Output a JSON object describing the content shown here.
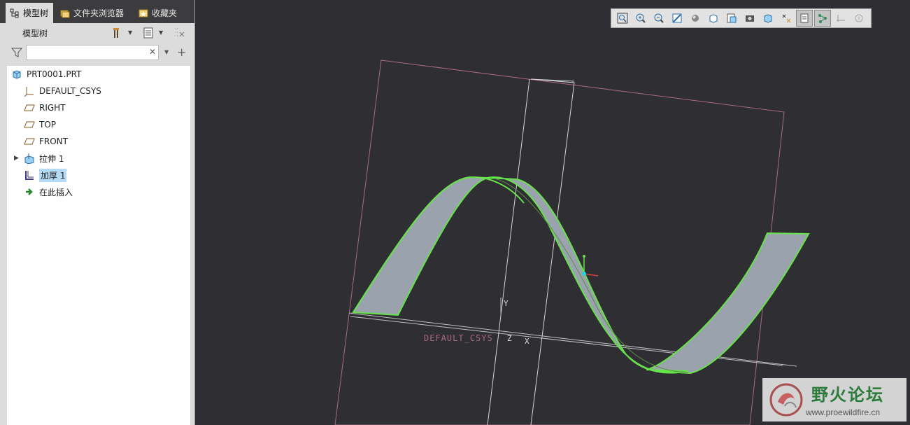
{
  "tabs": [
    {
      "label": "模型树",
      "icon": "tree-icon",
      "active": true
    },
    {
      "label": "文件夹浏览器",
      "icon": "folder-browser-icon",
      "active": false
    },
    {
      "label": "收藏夹",
      "icon": "favorites-icon",
      "active": false
    }
  ],
  "tree_header": {
    "title": "模型树",
    "settings_icon": "tools-icon",
    "show_icon": "list-icon",
    "extra_icon": "columns-icon"
  },
  "filter": {
    "placeholder": "",
    "value": "",
    "clear_icon": "close-icon",
    "add_icon": "plus-icon"
  },
  "tree": {
    "root": {
      "label": "PRT0001.PRT",
      "icon": "part-icon"
    },
    "items": [
      {
        "label": "DEFAULT_CSYS",
        "icon": "csys-icon"
      },
      {
        "label": "RIGHT",
        "icon": "datum-plane-icon"
      },
      {
        "label": "TOP",
        "icon": "datum-plane-icon"
      },
      {
        "label": "FRONT",
        "icon": "datum-plane-icon"
      },
      {
        "label": "拉伸 1",
        "icon": "extrude-icon",
        "expandable": true
      },
      {
        "label": "加厚 1",
        "icon": "thicken-icon",
        "selected": true
      },
      {
        "label": "在此插入",
        "icon": "insert-here-icon"
      }
    ]
  },
  "viewport": {
    "csys_label": "DEFAULT_CSYS",
    "axis_y": "Y",
    "axis_z": "Z",
    "axis_x": "X",
    "highlight_color": "#66e24a",
    "surface_color": "#9aa3ad",
    "background": "#2f2f33"
  },
  "view_toolbar": [
    "refit-icon",
    "zoom-in-icon",
    "zoom-out-icon",
    "repaint-icon",
    "display-style-icon",
    "saved-views-icon",
    "view-manager-icon",
    "perspective-icon",
    "spin-center-icon",
    "annotation-display-icon",
    "plane-display-icon",
    "axis-display-icon",
    "point-display-icon",
    "csys-display-icon"
  ],
  "watermark": {
    "title": "野火论坛",
    "url": "www.proewildfire.cn"
  }
}
